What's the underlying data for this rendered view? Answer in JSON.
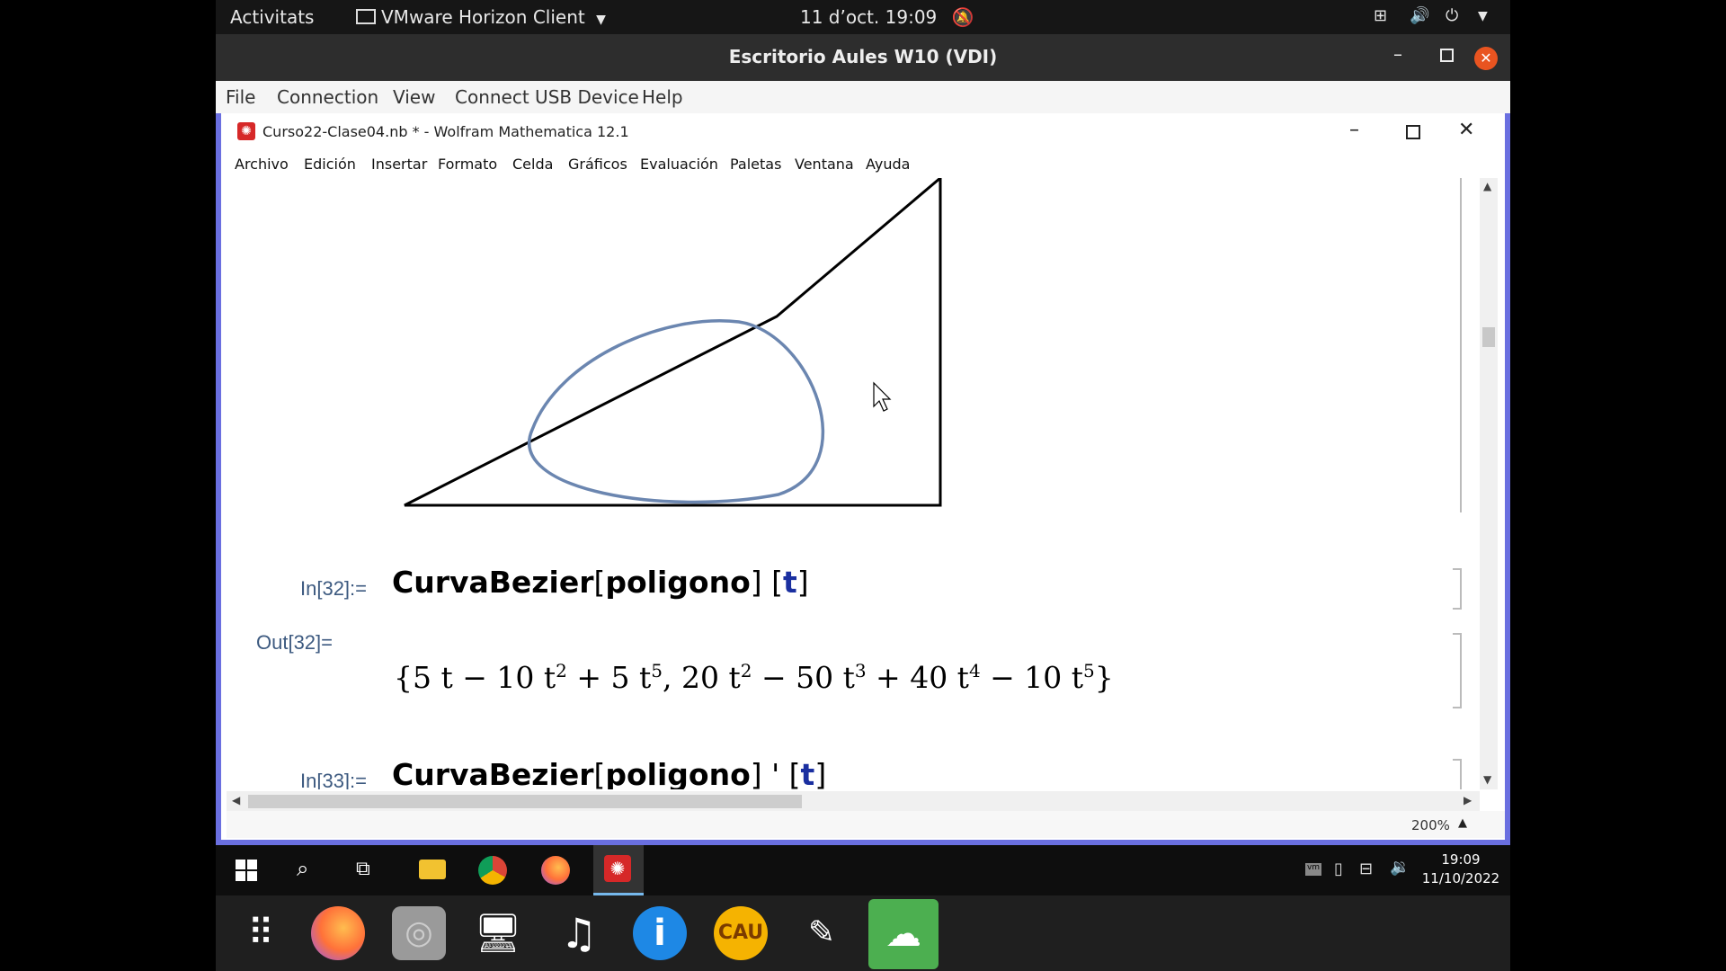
{
  "gnome": {
    "activities": "Activitats",
    "app_name": "VMware Horizon Client",
    "clock": "11 d’oct.  19:09"
  },
  "vmware": {
    "title": "Escritorio Aules W10 (VDI)",
    "menu": [
      "File",
      "Connection",
      "View",
      "Connect USB Device",
      "Help"
    ]
  },
  "mathematica": {
    "title": "Curso22-Clase04.nb * - Wolfram Mathematica 12.1",
    "menu": [
      "Archivo",
      "Edición",
      "Insertar",
      "Formato",
      "Celda",
      "Gráficos",
      "Evaluación",
      "Paletas",
      "Ventana",
      "Ayuda"
    ],
    "cells": {
      "in32_label": "In[32]:=",
      "in32_func": "CurvaBezier",
      "in32_arg": "poligono",
      "in32_var": "t",
      "out32_label": "Out[32]=",
      "in33_label": "In[33]:=",
      "in33_func": "CurvaBezier",
      "in33_arg": "poligono",
      "in33_var": "t"
    },
    "zoom": "200%"
  },
  "windows_tray": {
    "time": "19:09",
    "date": "11/10/2022"
  },
  "colors": {
    "vdi_border": "#6a6fe0",
    "curve": "#6b86b0",
    "label": "#3d5a80"
  }
}
